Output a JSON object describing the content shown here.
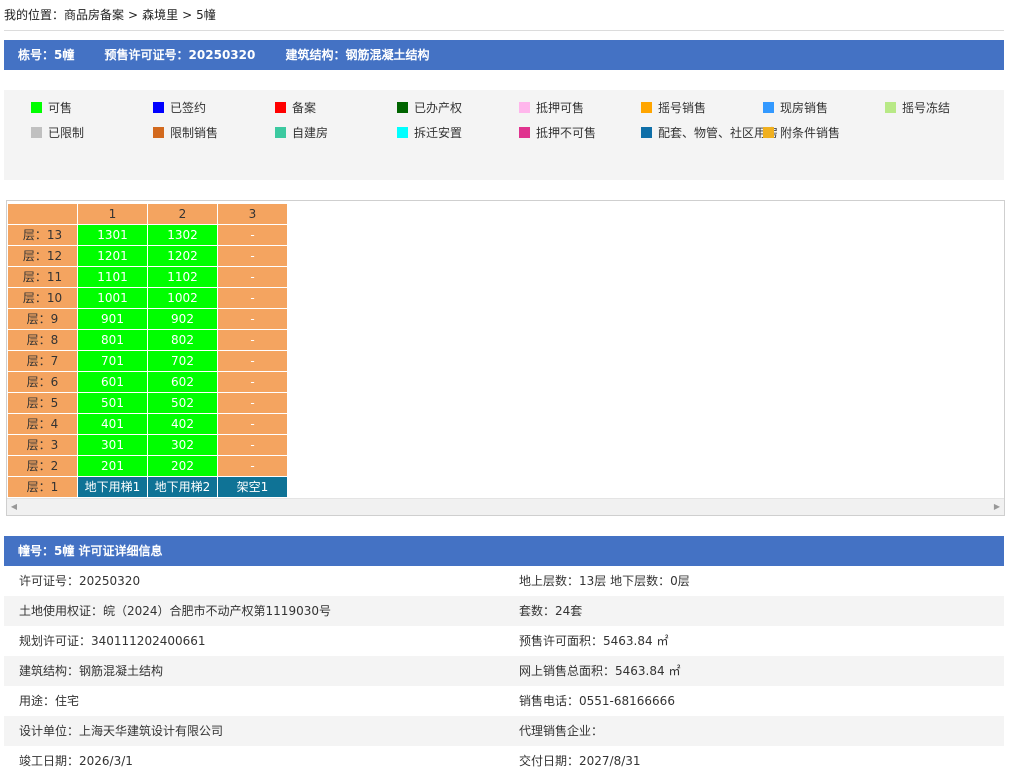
{
  "breadcrumb": {
    "prefix": "我的位置：",
    "items": [
      "商品房备案",
      "森境里",
      "5幢"
    ],
    "separator": ">"
  },
  "building_bar": {
    "building_label": "栋号：5幢",
    "permit_label": "预售许可证号：20250320",
    "structure_label": "建筑结构：钢筋混凝土结构"
  },
  "legend": [
    {
      "label": "可售",
      "color": "#00ff00"
    },
    {
      "label": "已签约",
      "color": "#0000ff"
    },
    {
      "label": "备案",
      "color": "#ff0000"
    },
    {
      "label": "已办产权",
      "color": "#006400"
    },
    {
      "label": "抵押可售",
      "color": "#ffb6ec"
    },
    {
      "label": "摇号销售",
      "color": "#ffa500"
    },
    {
      "label": "现房销售",
      "color": "#3399ff"
    },
    {
      "label": "摇号冻结",
      "color": "#b8e986"
    },
    {
      "label": "已限制",
      "color": "#c0c0c0"
    },
    {
      "label": "限制销售",
      "color": "#d2691e"
    },
    {
      "label": "自建房",
      "color": "#3cc9a0"
    },
    {
      "label": "拆迁安置",
      "color": "#00ffff"
    },
    {
      "label": "抵押不可售",
      "color": "#e0338f"
    },
    {
      "label": "配套、物管、社区用房",
      "color": "#0f6fa8"
    },
    {
      "label": "附条件销售",
      "color": "#f0b020"
    }
  ],
  "unit_table": {
    "columns": [
      "",
      "1",
      "2",
      "3"
    ],
    "rows": [
      {
        "floor": "层：13",
        "cells": [
          "1301",
          "1302",
          "-"
        ]
      },
      {
        "floor": "层：12",
        "cells": [
          "1201",
          "1202",
          "-"
        ]
      },
      {
        "floor": "层：11",
        "cells": [
          "1101",
          "1102",
          "-"
        ]
      },
      {
        "floor": "层：10",
        "cells": [
          "1001",
          "1002",
          "-"
        ]
      },
      {
        "floor": "层：9",
        "cells": [
          "901",
          "902",
          "-"
        ]
      },
      {
        "floor": "层：8",
        "cells": [
          "801",
          "802",
          "-"
        ]
      },
      {
        "floor": "层：7",
        "cells": [
          "701",
          "702",
          "-"
        ]
      },
      {
        "floor": "层：6",
        "cells": [
          "601",
          "602",
          "-"
        ]
      },
      {
        "floor": "层：5",
        "cells": [
          "501",
          "502",
          "-"
        ]
      },
      {
        "floor": "层：4",
        "cells": [
          "401",
          "402",
          "-"
        ]
      },
      {
        "floor": "层：3",
        "cells": [
          "301",
          "302",
          "-"
        ]
      },
      {
        "floor": "层：2",
        "cells": [
          "201",
          "202",
          "-"
        ]
      },
      {
        "floor": "层：1",
        "cells": [
          "地下用梯1",
          "地下用梯2",
          "架空1"
        ]
      }
    ]
  },
  "permit_bar": {
    "title": "幢号：5幢 许可证详细信息"
  },
  "details": [
    {
      "left": "许可证号：20250320",
      "right": "地上层数：13层  地下层数：0层"
    },
    {
      "left": "土地使用权证：皖（2024）合肥市不动产权第1119030号",
      "right": "套数：24套"
    },
    {
      "left": "规划许可证：340111202400661",
      "right": "预售许可面积：5463.84 ㎡"
    },
    {
      "left": "建筑结构：钢筋混凝土结构",
      "right": "网上销售总面积：5463.84 ㎡"
    },
    {
      "left": "用途：住宅",
      "right": "销售电话：0551-68166666"
    },
    {
      "left": "设计单位：上海天华建筑设计有限公司",
      "right": "代理销售企业："
    },
    {
      "left": "竣工日期：2026/3/1",
      "right": "交付日期：2027/8/31"
    }
  ]
}
